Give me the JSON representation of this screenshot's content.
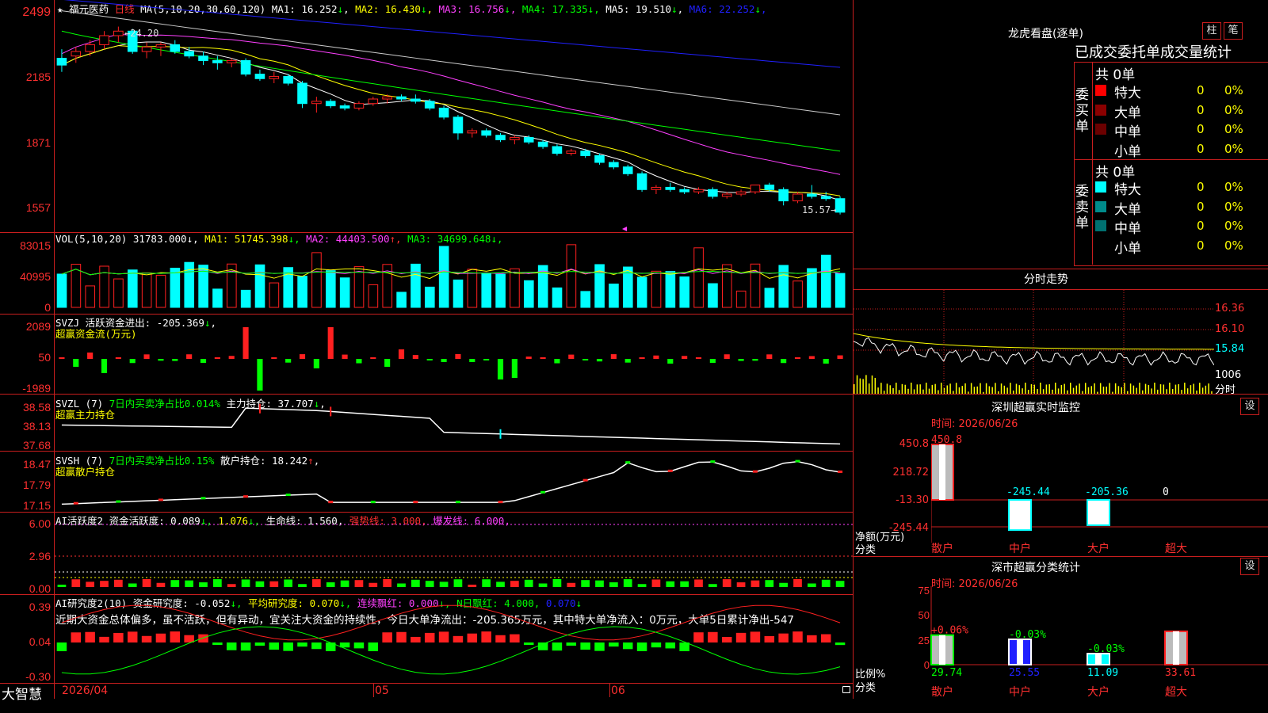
{
  "stock": {
    "name": "福元医药",
    "period": "日线",
    "ma_header": "MA(5,10,20,30,60,120)",
    "ma_items": [
      {
        "label": "MA1:",
        "value": "16.252",
        "arrow": "↓",
        "color": "#ffffff"
      },
      {
        "label": "MA2:",
        "value": "16.430",
        "arrow": "↓",
        "color": "#ffff00"
      },
      {
        "label": "MA3:",
        "value": "16.756",
        "arrow": "↓",
        "color": "#ff40ff"
      },
      {
        "label": "MA4:",
        "value": "17.335",
        "arrow": "↓",
        "color": "#00ff00"
      },
      {
        "label": "MA5:",
        "value": "19.510",
        "arrow": "↓",
        "color": "#ffffff"
      },
      {
        "label": "MA6:",
        "value": "22.252",
        "arrow": "↓",
        "color": "#2020ff"
      }
    ],
    "price_ticks": [
      "2499",
      "2185",
      "1871",
      "1557"
    ],
    "high_label": "24.20",
    "low_label": "15.57"
  },
  "vol": {
    "header": "VOL(5,10,20)",
    "value": "31783.000",
    "items": [
      {
        "label": "MA1:",
        "value": "51745.398",
        "arrow": "↓",
        "color": "#ffff00"
      },
      {
        "label": "MA2:",
        "value": "44403.500",
        "arrow": "↑",
        "color": "#ff40ff"
      },
      {
        "label": "MA3:",
        "value": "34699.648",
        "arrow": "↓",
        "color": "#00ff00"
      }
    ],
    "ticks": [
      "83015",
      "40995",
      "0"
    ]
  },
  "svzj": {
    "header": "SVZJ",
    "label": "活跃资金进出:",
    "value": "-205.369",
    "arrow": "↓",
    "subtitle": "超赢资金流(万元)",
    "ticks": [
      "2089",
      "50",
      "-1989"
    ]
  },
  "svzl": {
    "header": "SVZL (7)",
    "ratio": "7日内买卖净占比0.014%",
    "label": "主力持仓:",
    "value": "37.707",
    "arrow": "↓",
    "subtitle": "超赢主力持仓",
    "ticks": [
      "38.58",
      "38.13",
      "37.68"
    ]
  },
  "svsh": {
    "header": "SVSH (7)",
    "ratio": "7日内买卖净占比0.15%",
    "label": "散户持仓:",
    "value": "18.242",
    "arrow": "↑",
    "subtitle": "超赢散户持仓",
    "ticks": [
      "18.47",
      "17.79",
      "17.15"
    ]
  },
  "ai_active": {
    "header": "AI活跃度2",
    "label": "资金活跃度:",
    "v1": "0.089",
    "v2": "1.076",
    "life": "生命线: 1.560,",
    "strong": "强势线: 3.000,",
    "burst": "爆发线: 6.000,",
    "ticks": [
      "6.00",
      "2.96",
      "0.00"
    ]
  },
  "ai_research": {
    "header": "AI研究度2(10)",
    "label": "资金研究度:",
    "value": "-0.052",
    "avg": "平均研究度: 0.070",
    "lian": "连续飘红: 0.000",
    "nday": "N日飘红: 4.000,",
    "last": "0.070",
    "commentary": "近期大资金总体偏多，虽不活跃，但有异动，宜关注大资金的持续性，今日大单净流出：-205.365万元，其中特大单净流入：0万元，大单5日累计净出-547",
    "ticks": [
      "0.39",
      "0.04",
      "-0.30"
    ]
  },
  "footer": {
    "brand": "大智慧",
    "dates": [
      "2026/04",
      "05",
      "06"
    ]
  },
  "right": {
    "lhb_title": "龙虎看盘(逐单)",
    "btn_column": "柱",
    "btn_stroke": "笔",
    "stat_title": "已成交委托单成交量统计",
    "buy_label": "委买单",
    "sell_label": "委卖单",
    "buy_total": "共 0单",
    "sell_total": "共 0单",
    "buy_rows": [
      {
        "name": "特大",
        "count": "0",
        "pct": "0%",
        "color": "#ff0000"
      },
      {
        "name": "大单",
        "count": "0",
        "pct": "0%",
        "color": "#8b0000"
      },
      {
        "name": "中单",
        "count": "0",
        "pct": "0%",
        "color": "#6b0000"
      },
      {
        "name": "小单",
        "count": "0",
        "pct": "0%",
        "color": ""
      }
    ],
    "sell_rows": [
      {
        "name": "特大",
        "count": "0",
        "pct": "0%",
        "color": "#00ffff"
      },
      {
        "name": "大单",
        "count": "0",
        "pct": "0%",
        "color": "#008b8b"
      },
      {
        "name": "中单",
        "count": "0",
        "pct": "0%",
        "color": "#007070"
      },
      {
        "name": "小单",
        "count": "0",
        "pct": "0%",
        "color": ""
      }
    ],
    "intraday_title": "分时走势",
    "intraday_ticks": [
      "16.36",
      "16.10",
      "15.84"
    ],
    "intraday_vol": "1006",
    "intraday_fen": "分时",
    "sz_title": "深圳超赢实时监控",
    "set_label": "设",
    "sz_time": "时间: 2026/06/26",
    "sz_ticks": [
      "450.8",
      "218.72",
      "-13.30",
      "-245.44"
    ],
    "sz_ylabel": "净额(万元)",
    "sz_xlabel": "分类",
    "sz_values": [
      "450.8",
      "-245.44",
      "-205.36",
      "0"
    ],
    "sz_cats": [
      "散户",
      "中户",
      "大户",
      "超大"
    ],
    "cls_title": "深市超赢分类统计",
    "cls_time": "时间: 2026/06/26",
    "cls_ticks": [
      "75",
      "50",
      "25",
      "0"
    ],
    "cls_ylabel": "比例%",
    "cls_xlabel": "分类",
    "cls_pct": [
      "+0.06%",
      "-0.03%",
      "-0.03%"
    ],
    "cls_values": [
      "29.74",
      "25.55",
      "11.09",
      "33.61"
    ],
    "cls_cats": [
      "散户",
      "中户",
      "大户",
      "超大"
    ]
  },
  "chart_data": {
    "type": "candlestick",
    "series_colors": {
      "up": "#ff2020",
      "down": "#00ffff"
    },
    "ohlc": [
      [
        22.8,
        23.2,
        22.2,
        22.5
      ],
      [
        22.9,
        23.3,
        22.6,
        23.1
      ],
      [
        23.1,
        23.6,
        22.9,
        23.4
      ],
      [
        23.4,
        24.0,
        23.2,
        23.8
      ],
      [
        23.8,
        24.2,
        23.5,
        24.0
      ],
      [
        24.0,
        24.1,
        23.0,
        23.1
      ],
      [
        23.1,
        23.5,
        22.8,
        23.3
      ],
      [
        23.3,
        23.5,
        22.9,
        23.4
      ],
      [
        23.4,
        23.6,
        23.0,
        23.1
      ],
      [
        23.1,
        23.3,
        22.8,
        22.9
      ],
      [
        22.9,
        23.1,
        22.5,
        22.7
      ],
      [
        22.7,
        22.9,
        22.3,
        22.6
      ],
      [
        22.6,
        22.8,
        22.4,
        22.7
      ],
      [
        22.7,
        22.8,
        22.0,
        22.1
      ],
      [
        22.1,
        22.3,
        21.8,
        21.9
      ],
      [
        21.9,
        22.2,
        21.7,
        22.0
      ],
      [
        22.0,
        22.1,
        21.6,
        21.7
      ],
      [
        21.7,
        21.8,
        20.6,
        20.8
      ],
      [
        20.8,
        21.1,
        20.4,
        20.9
      ],
      [
        20.9,
        21.0,
        20.6,
        20.7
      ],
      [
        20.7,
        20.8,
        20.5,
        20.6
      ],
      [
        20.6,
        20.9,
        20.5,
        20.8
      ],
      [
        20.8,
        21.1,
        20.7,
        21.0
      ],
      [
        21.0,
        21.2,
        20.8,
        21.1
      ],
      [
        21.1,
        21.2,
        20.9,
        21.0
      ],
      [
        21.0,
        21.2,
        20.8,
        20.9
      ],
      [
        20.9,
        21.0,
        20.5,
        20.6
      ],
      [
        20.6,
        20.7,
        20.1,
        20.2
      ],
      [
        20.2,
        20.3,
        19.2,
        19.5
      ],
      [
        19.5,
        19.7,
        19.3,
        19.6
      ],
      [
        19.6,
        19.7,
        19.3,
        19.4
      ],
      [
        19.4,
        19.5,
        19.1,
        19.2
      ],
      [
        19.2,
        19.4,
        19.0,
        19.3
      ],
      [
        19.3,
        19.4,
        19.0,
        19.1
      ],
      [
        19.1,
        19.2,
        18.8,
        18.9
      ],
      [
        18.9,
        19.0,
        18.5,
        18.6
      ],
      [
        18.6,
        18.8,
        18.5,
        18.7
      ],
      [
        18.7,
        18.8,
        18.4,
        18.5
      ],
      [
        18.5,
        18.6,
        18.1,
        18.2
      ],
      [
        18.2,
        18.3,
        17.9,
        18.0
      ],
      [
        18.0,
        18.1,
        17.6,
        17.7
      ],
      [
        17.7,
        17.8,
        16.9,
        17.0
      ],
      [
        17.0,
        17.2,
        16.8,
        17.1
      ],
      [
        17.1,
        17.3,
        16.9,
        17.0
      ],
      [
        17.0,
        17.1,
        16.8,
        16.9
      ],
      [
        16.9,
        17.1,
        16.8,
        17.0
      ],
      [
        17.0,
        17.1,
        16.6,
        16.7
      ],
      [
        16.7,
        16.9,
        16.6,
        16.8
      ],
      [
        16.8,
        17.0,
        16.7,
        16.9
      ],
      [
        16.9,
        17.1,
        16.8,
        17.2
      ],
      [
        17.2,
        17.3,
        16.9,
        17.0
      ],
      [
        17.0,
        17.1,
        16.3,
        16.5
      ],
      [
        16.5,
        16.9,
        16.4,
        16.8
      ],
      [
        16.8,
        17.2,
        16.6,
        16.7
      ],
      [
        16.7,
        16.9,
        16.5,
        16.6
      ],
      [
        16.6,
        16.7,
        15.9,
        16.0
      ]
    ]
  }
}
